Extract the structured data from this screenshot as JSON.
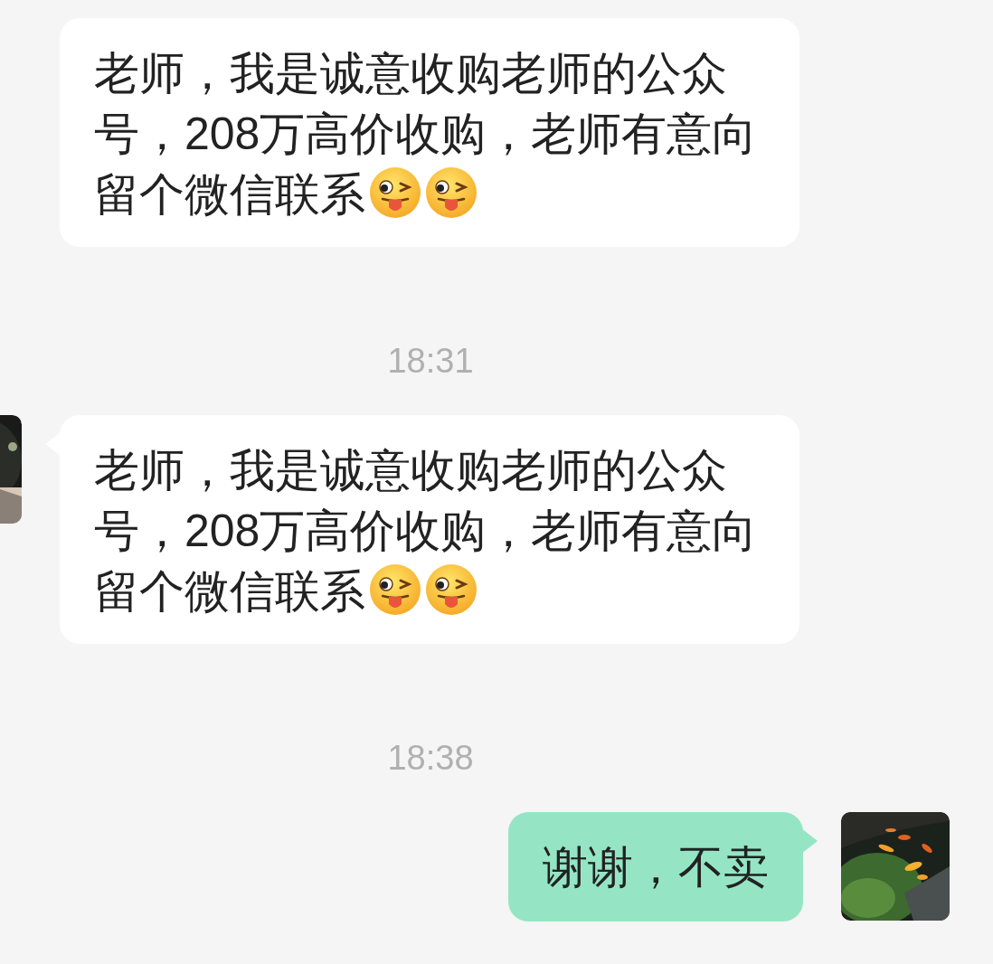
{
  "messages": [
    {
      "kind": "received",
      "text": "老师，我是诚意收购老师的公众号，208万高价收购，老师有意向留个微信联系",
      "emojis": [
        {
          "kind": "wink-tongue"
        },
        {
          "kind": "wink-tongue"
        }
      ]
    },
    {
      "kind": "time",
      "text": "18:31"
    },
    {
      "kind": "received",
      "text": "老师，我是诚意收购老师的公众号，208万高价收购，老师有意向留个微信联系",
      "emojis": [
        {
          "kind": "wink-tongue"
        },
        {
          "kind": "wink-tongue"
        }
      ]
    },
    {
      "kind": "time",
      "text": "18:38"
    },
    {
      "kind": "sent",
      "text": "谢谢，不卖"
    }
  ]
}
